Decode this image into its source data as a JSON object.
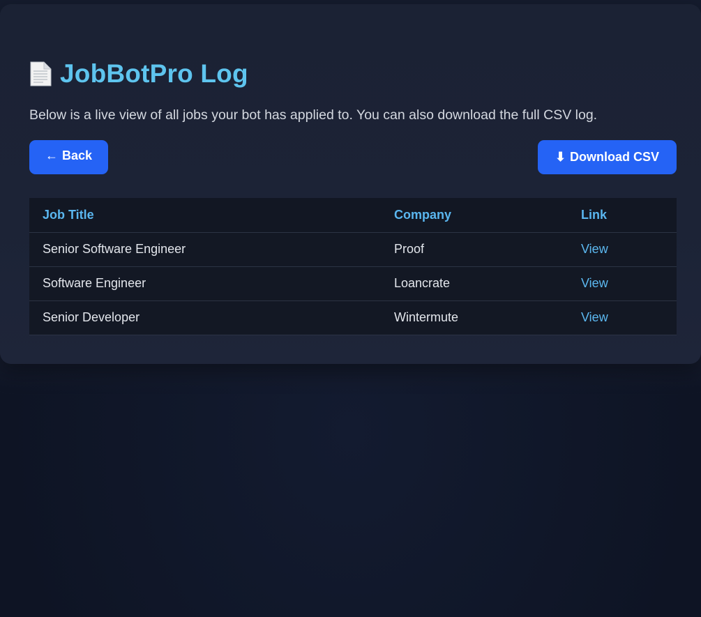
{
  "header": {
    "icon": "document-icon",
    "title": "JobBotPro Log",
    "subtitle": "Below is a live view of all jobs your bot has applied to. You can also download the full CSV log."
  },
  "actions": {
    "back": {
      "glyph": "←",
      "label": "Back"
    },
    "download": {
      "glyph": "⬇",
      "label": "Download CSV"
    }
  },
  "table": {
    "columns": [
      "Job Title",
      "Company",
      "Link"
    ],
    "rows": [
      {
        "title": "Senior Software Engineer",
        "company": "Proof",
        "link": "View"
      },
      {
        "title": "Software Engineer",
        "company": "Loancrate",
        "link": "View"
      },
      {
        "title": "Senior Developer",
        "company": "Wintermute",
        "link": "View"
      }
    ]
  },
  "colors": {
    "accent": "#5ec4ee",
    "button": "#2563f5",
    "background": "#0f1628",
    "card": "#1c2336"
  }
}
